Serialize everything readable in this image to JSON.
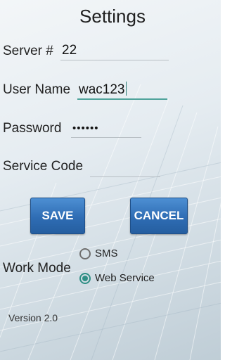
{
  "title": "Settings",
  "server": {
    "label": "Server #",
    "value": "22"
  },
  "username": {
    "label": "User Name",
    "value": "wac123"
  },
  "password": {
    "label": "Password",
    "value": "••••••"
  },
  "service_code": {
    "label": "Service Code",
    "value": ""
  },
  "buttons": {
    "save": "SAVE",
    "cancel": "CANCEL"
  },
  "work_mode": {
    "label": "Work Mode",
    "options": [
      {
        "label": "SMS",
        "selected": false
      },
      {
        "label": "Web Service",
        "selected": true
      }
    ]
  },
  "version": "Version 2.0",
  "colors": {
    "button": "#2f6db4",
    "accent": "#2f8f85"
  }
}
